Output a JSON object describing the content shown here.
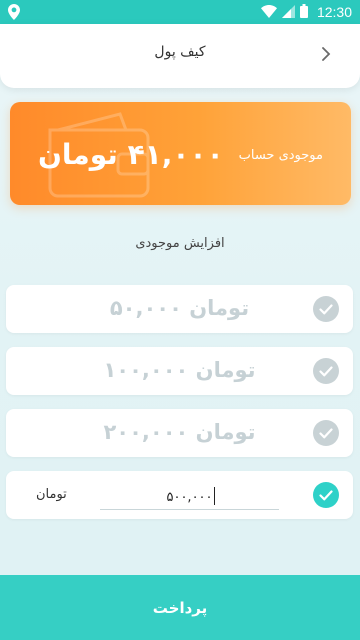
{
  "status_bar": {
    "time": "12:30"
  },
  "header": {
    "title": "کیف پول"
  },
  "balance": {
    "label": "موجودی حساب",
    "amount": "۴۱,۰۰۰ تومان"
  },
  "section": {
    "title": "افزایش موجودی"
  },
  "options": [
    {
      "label": "۵۰,۰۰۰ تومان"
    },
    {
      "label": "۱۰۰,۰۰۰ تومان"
    },
    {
      "label": "۲۰۰,۰۰۰ تومان"
    }
  ],
  "custom": {
    "unit": "تومان",
    "value": "۵۰۰,۰۰۰",
    "selected": true
  },
  "pay_button": {
    "label": "پرداخت"
  },
  "colors": {
    "status_bar": "#2bc9bd",
    "primary": "#36cfc4",
    "card_orange": "#ff8a2a",
    "check_inactive": "#c8d2d5",
    "check_active": "#2ed1c8"
  }
}
